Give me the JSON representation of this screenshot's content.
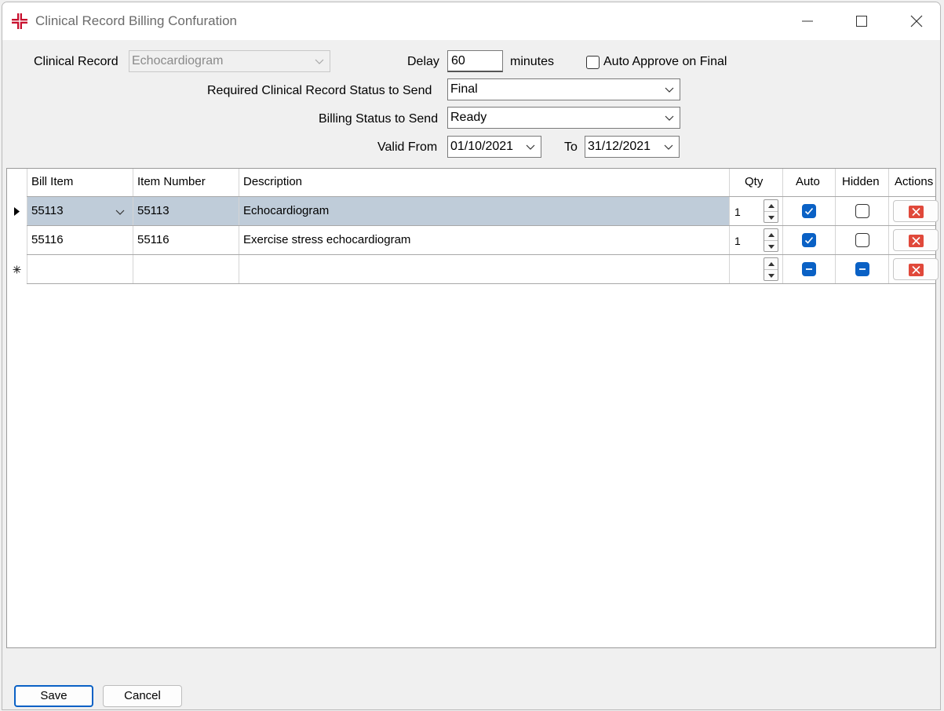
{
  "window": {
    "title": "Clinical Record Billing Confuration"
  },
  "form": {
    "clinical_record_label": "Clinical Record",
    "clinical_record_value": "Echocardiogram",
    "delay_label": "Delay",
    "delay_value": "60",
    "delay_unit": "minutes",
    "auto_approve_label": "Auto Approve on Final",
    "auto_approve_checked": false,
    "required_status_label": "Required Clinical Record Status to Send",
    "required_status_value": "Final",
    "billing_status_label": "Billing Status to Send",
    "billing_status_value": "Ready",
    "valid_from_label": "Valid From",
    "valid_from_value": "01/10/2021",
    "to_label": "To",
    "to_value": "31/12/2021"
  },
  "grid": {
    "columns": [
      "Bill Item",
      "Item Number",
      "Description",
      "Qty",
      "Auto",
      "Hidden",
      "Actions"
    ],
    "rows": [
      {
        "bill_item": "55113",
        "item_number": "55113",
        "description": "Echocardiogram",
        "qty": "1",
        "auto": true,
        "hidden": false,
        "selected": true
      },
      {
        "bill_item": "55116",
        "item_number": "55116",
        "description": "Exercise stress echocardiogram",
        "qty": "1",
        "auto": true,
        "hidden": false,
        "selected": false
      }
    ],
    "new_row": {
      "bill_item": "",
      "item_number": "",
      "description": "",
      "qty": "",
      "auto": "indeterminate",
      "hidden": "indeterminate"
    }
  },
  "buttons": {
    "save": "Save",
    "cancel": "Cancel"
  },
  "colors": {
    "accent": "#0a61c5",
    "selected_row": "#bfccd9",
    "delete": "#e0483a",
    "brand_red": "#c8102e"
  },
  "icons": [
    "app-cross-icon",
    "minimize-icon",
    "maximize-icon",
    "close-icon",
    "chevron-down-icon",
    "row-pointer-icon",
    "new-row-icon",
    "spin-up-icon",
    "spin-down-icon",
    "delete-icon"
  ]
}
